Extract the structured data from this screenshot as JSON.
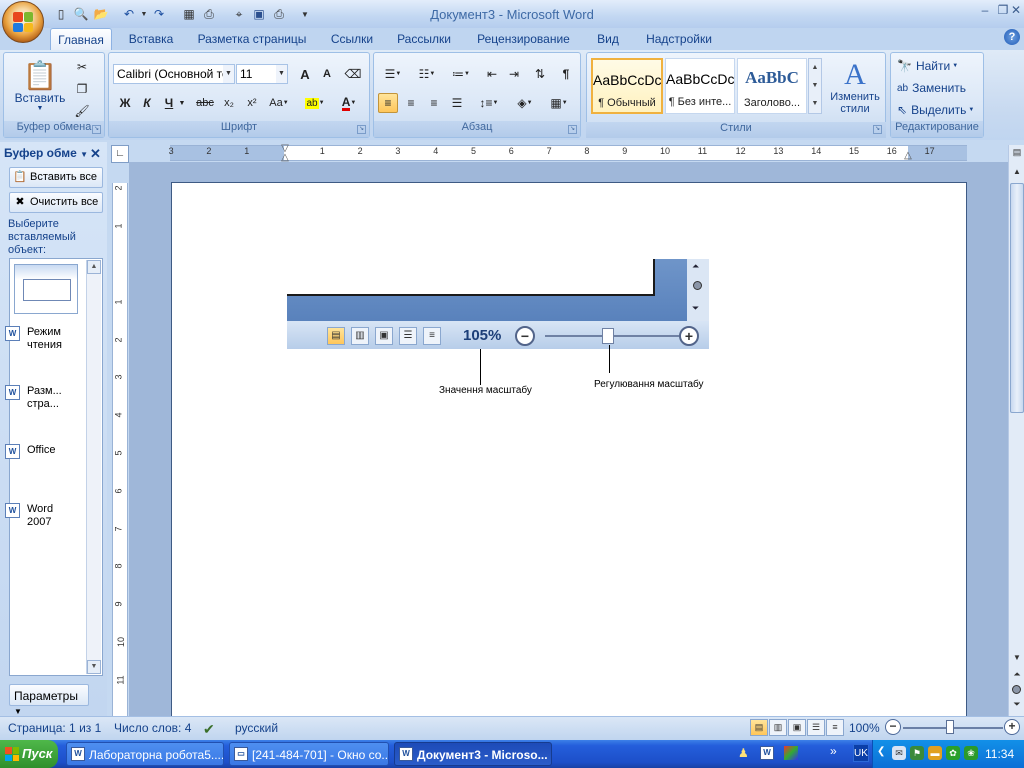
{
  "window": {
    "title": "Документ3 - Microsoft Word",
    "controls": {
      "minimize": "–",
      "restore": "❐",
      "close": "✕"
    }
  },
  "qat": {
    "icons": [
      "new-doc-icon",
      "preview-icon",
      "open-icon",
      "undo-icon",
      "redo-icon",
      "page-layout-icon",
      "print-icon",
      "cursor-icon",
      "save-icon",
      "quick-print-icon",
      "customize-icon"
    ]
  },
  "tabs": [
    "Главная",
    "Вставка",
    "Разметка страницы",
    "Ссылки",
    "Рассылки",
    "Рецензирование",
    "Вид",
    "Надстройки"
  ],
  "help": "?",
  "ribbon": {
    "clipboard": {
      "paste_label": "Вставить",
      "group_label": "Буфер обмена"
    },
    "font": {
      "font_name": "Calibri (Основной те",
      "font_size": "11",
      "group_label": "Шрифт",
      "bold": "Ж",
      "italic": "К",
      "underline": "Ч",
      "strike": "abc",
      "sub": "x₂",
      "sup": "x²",
      "case": "Aa",
      "grow": "A",
      "shrink": "A"
    },
    "paragraph": {
      "group_label": "Абзац",
      "pilcrow": "¶"
    },
    "styles": {
      "group_label": "Стили",
      "tiles": [
        {
          "preview": "AaBbCcDc",
          "name": "¶ Обычный"
        },
        {
          "preview": "AaBbCcDc",
          "name": "¶ Без инте..."
        },
        {
          "preview": "AaBbC",
          "name": "Заголово..."
        }
      ],
      "change_styles": "Изменить стили"
    },
    "editing": {
      "group_label": "Редактирование",
      "find": "Найти",
      "replace": "Заменить",
      "select": "Выделить"
    }
  },
  "clipboard_pane": {
    "title": "Буфер обме",
    "paste_all": "Вставить все",
    "clear_all": "Очистить все",
    "hint": "Выберите вставляемый объект:",
    "items": [
      "Режим чтения",
      "Разм... стра...",
      "Office",
      "Word 2007"
    ],
    "params": "Параметры"
  },
  "ruler": {
    "h_numbers": [
      "3",
      "2",
      "1",
      "1",
      "2",
      "3",
      "4",
      "5",
      "6",
      "7",
      "8",
      "9",
      "10",
      "11",
      "12",
      "13",
      "14",
      "15",
      "16",
      "17"
    ],
    "v_numbers": [
      "2",
      "1",
      "1",
      "2",
      "3",
      "4",
      "5",
      "6",
      "7",
      "8",
      "9",
      "10",
      "11"
    ]
  },
  "embedded": {
    "zoom_value": "105%",
    "callout_zoom_value": "Значення масштабу",
    "callout_zoom_slider": "Регулювання масштабу"
  },
  "statusbar": {
    "page": "Страница: 1 из 1",
    "words": "Число слов: 4",
    "language": "русский",
    "zoom": "100%"
  },
  "taskbar": {
    "start": "Пуск",
    "tasks": [
      "Лабораторна робота5....",
      "[241-484-701] - Окно со...",
      "Документ3 - Microso..."
    ],
    "lang": "UK",
    "clock": "11:34"
  },
  "colors": {
    "accent": "#15428b",
    "ribbon_bg": "#c7d9f0",
    "taskbar": "#245edb",
    "start": "#2f8f2b"
  }
}
